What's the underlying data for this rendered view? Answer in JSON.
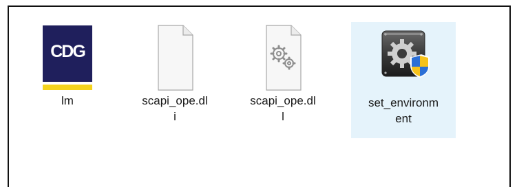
{
  "files": [
    {
      "label": "lm",
      "icon": "cdg-logo-icon"
    },
    {
      "label": "scapi_ope.dli",
      "icon": "blank-document-icon"
    },
    {
      "label": "scapi_ope.dll",
      "icon": "gear-document-icon"
    },
    {
      "label": "set_environment",
      "icon": "admin-gear-shield-icon"
    }
  ],
  "logo_text": "CDG",
  "colors": {
    "selection": "#e5f3fb",
    "logo_navy": "#1f1f5c",
    "logo_yellow": "#f4d31e",
    "shield_blue": "#2b6fd6",
    "shield_yellow": "#f6c21b"
  }
}
